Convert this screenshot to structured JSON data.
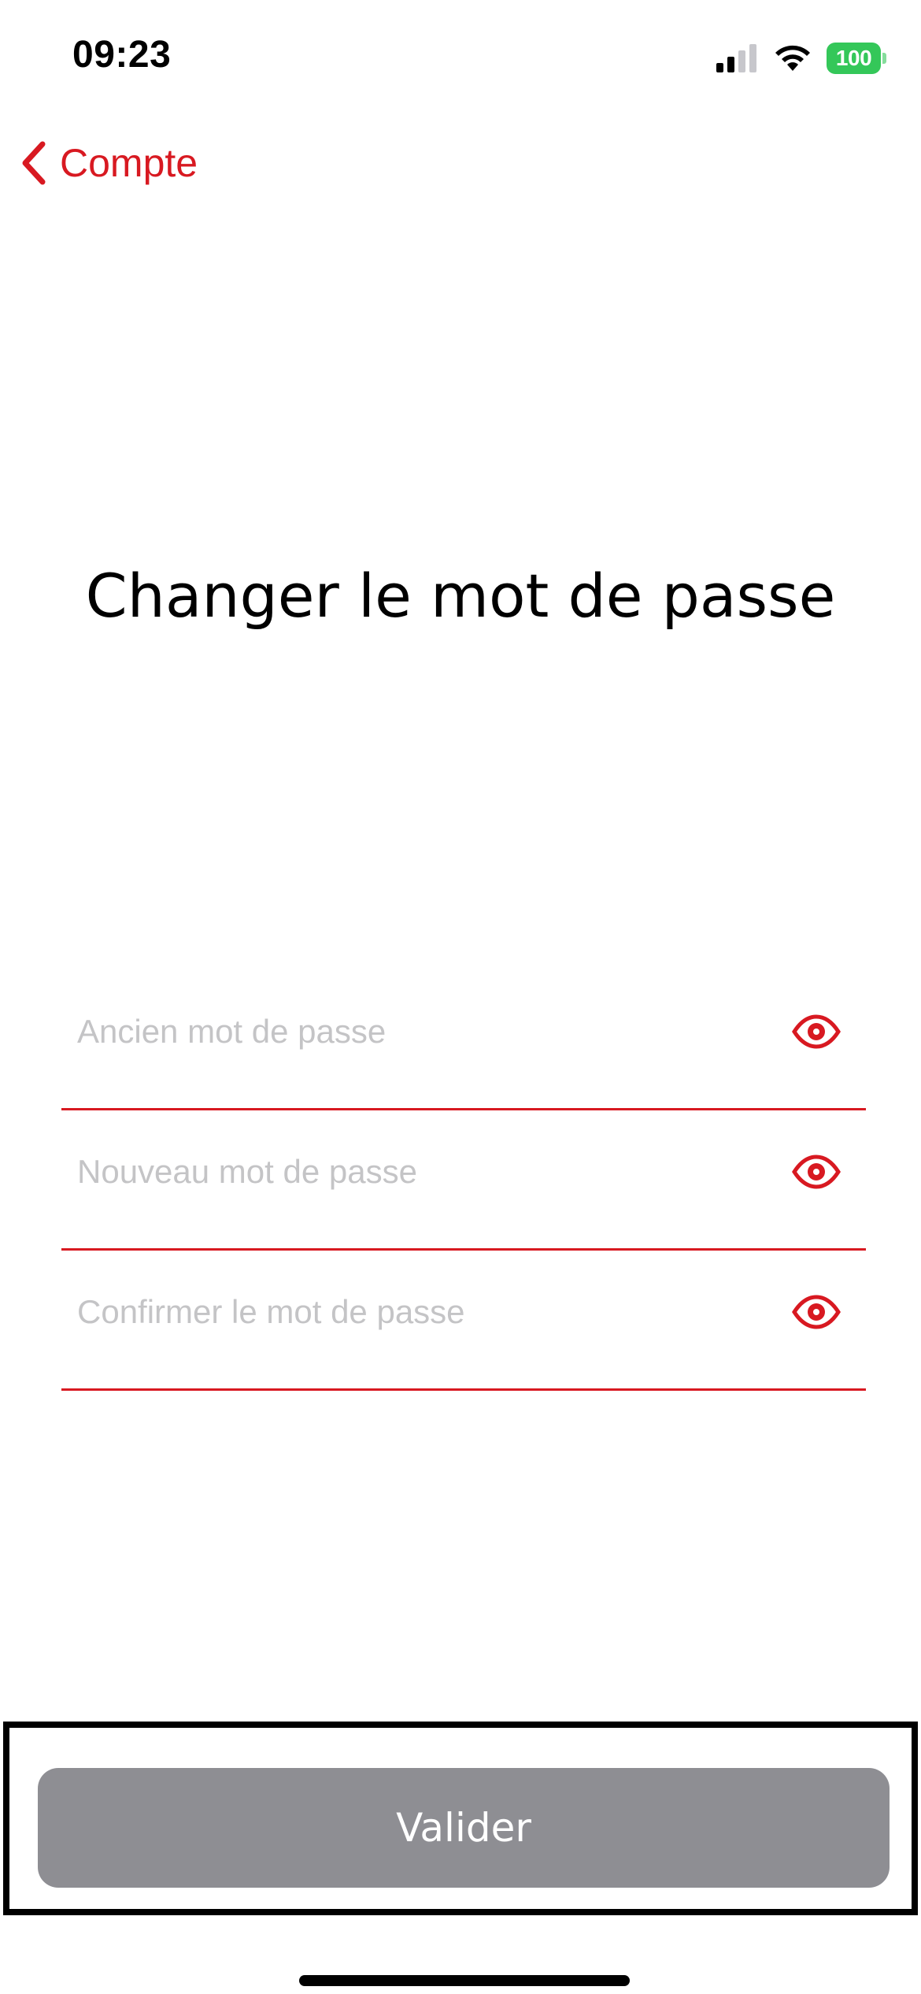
{
  "status_bar": {
    "time": "09:23",
    "battery_level": "100",
    "signal_icon": "cellular-signal-icon",
    "wifi_icon": "wifi-icon",
    "battery_color": "#34c759"
  },
  "nav": {
    "back_label": "Compte",
    "back_icon": "chevron-left-icon",
    "accent_color": "#d81921"
  },
  "page": {
    "title": "Changer le mot de passe"
  },
  "form": {
    "fields": [
      {
        "placeholder": "Ancien mot de passe",
        "value": "",
        "icon": "eye-icon"
      },
      {
        "placeholder": "Nouveau mot de passe",
        "value": "",
        "icon": "eye-icon"
      },
      {
        "placeholder": "Confirmer le mot de passe",
        "value": "",
        "icon": "eye-icon"
      }
    ]
  },
  "actions": {
    "submit_label": "Valider",
    "submit_color": "#8e8e93"
  }
}
